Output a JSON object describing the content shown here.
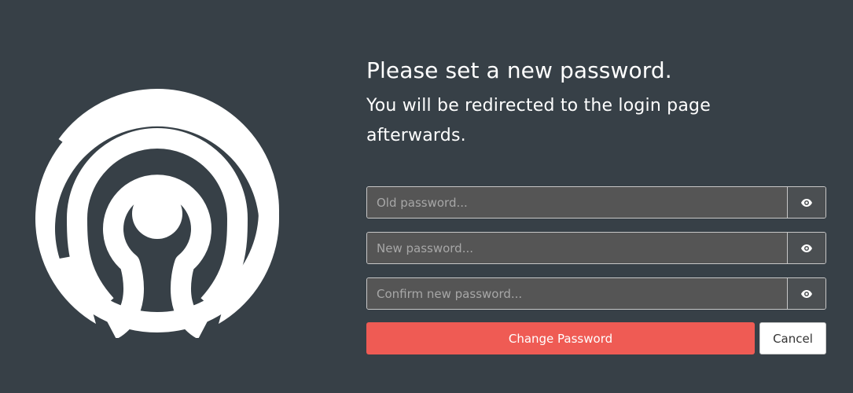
{
  "heading": {
    "title": "Please set a new password.",
    "subtitle": "You will be redirected to the login page afterwards."
  },
  "form": {
    "old_password": {
      "placeholder": "Old password...",
      "value": ""
    },
    "new_password": {
      "placeholder": "New password...",
      "value": ""
    },
    "confirm_password": {
      "placeholder": "Confirm new password...",
      "value": ""
    }
  },
  "buttons": {
    "submit_label": "Change Password",
    "cancel_label": "Cancel"
  },
  "icons": {
    "logo": "ceph-logo",
    "toggle_visibility": "eye-icon"
  },
  "colors": {
    "background": "#374047",
    "primary": "#ef5b54",
    "input_background": "#555555"
  }
}
